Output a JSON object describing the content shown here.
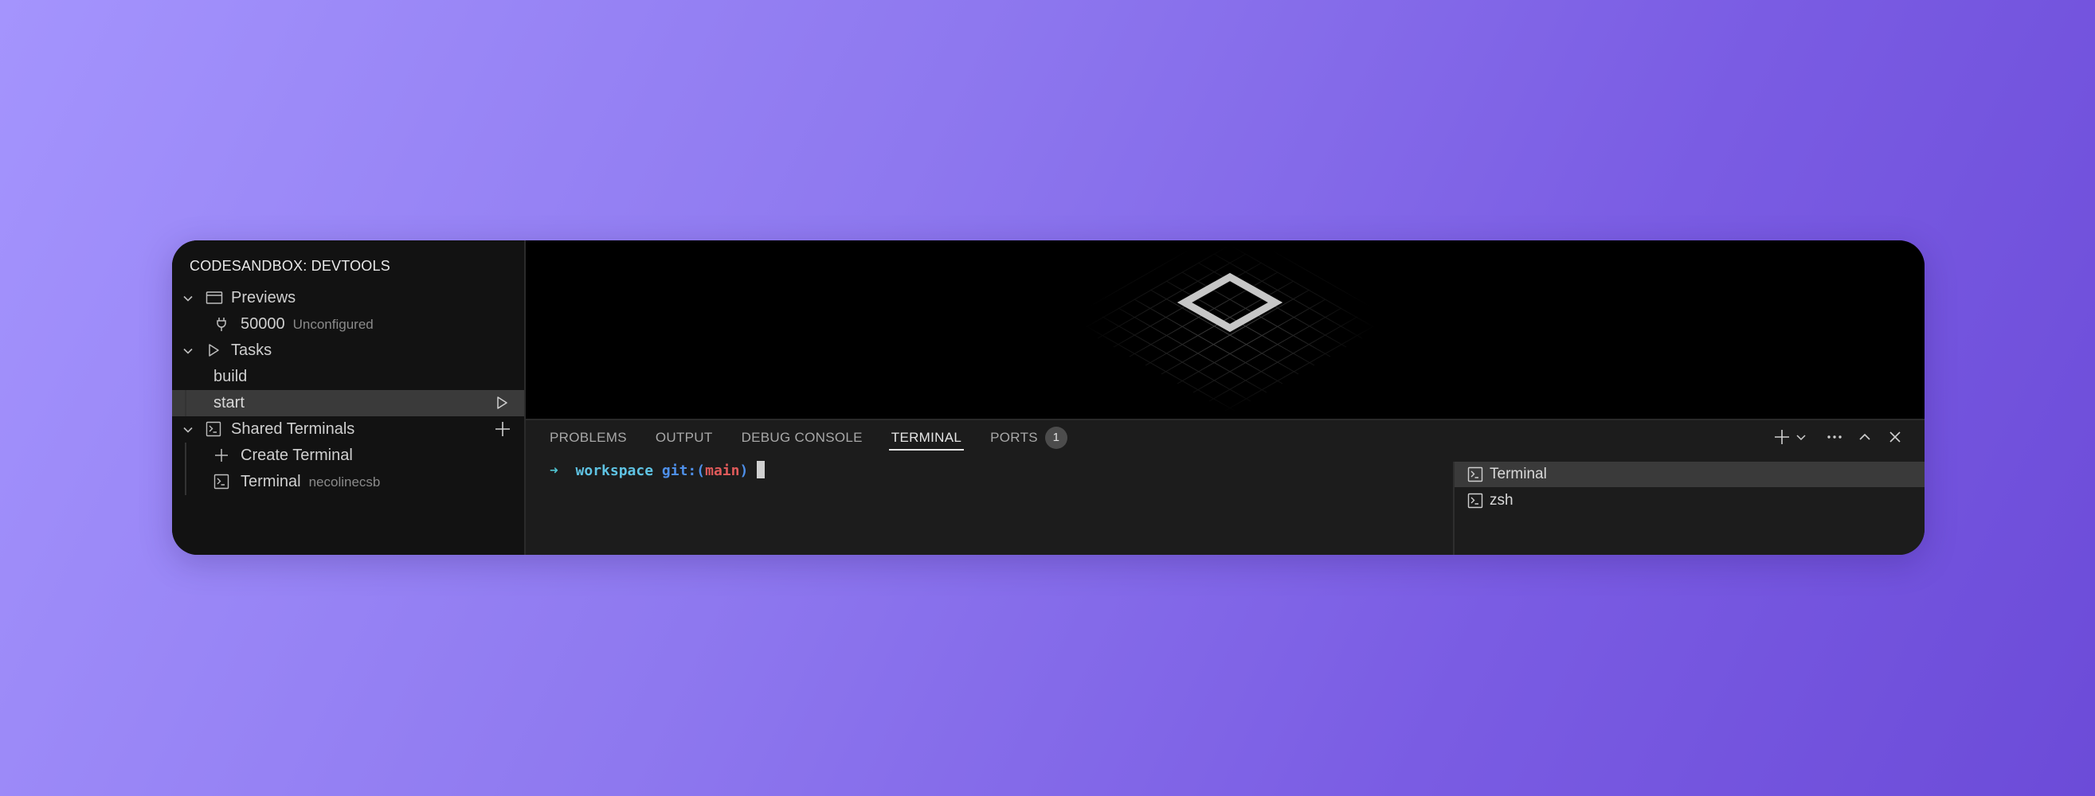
{
  "sidebar": {
    "title": "CODESANDBOX: DEVTOOLS",
    "previews": {
      "label": "Previews",
      "items": [
        {
          "port": "50000",
          "status": "Unconfigured"
        }
      ]
    },
    "tasks": {
      "label": "Tasks",
      "items": [
        {
          "label": "build"
        },
        {
          "label": "start"
        }
      ]
    },
    "shared_terminals": {
      "label": "Shared Terminals",
      "create_label": "Create Terminal",
      "items": [
        {
          "label": "Terminal",
          "owner": "necolinecsb"
        }
      ]
    }
  },
  "panel": {
    "tabs": [
      {
        "label": "PROBLEMS"
      },
      {
        "label": "OUTPUT"
      },
      {
        "label": "DEBUG CONSOLE"
      },
      {
        "label": "TERMINAL",
        "active": true
      },
      {
        "label": "PORTS",
        "badge": "1"
      }
    ],
    "terminal": {
      "arrow": "➜",
      "dir": "workspace",
      "git_prefix": "git:(",
      "branch": "main",
      "git_suffix": ")"
    },
    "terminal_list": [
      {
        "label": "Terminal",
        "selected": true
      },
      {
        "label": "zsh"
      }
    ]
  },
  "colors": {
    "accent_cyan": "#4fc2cf",
    "git_blue": "#4e8fe9",
    "branch_red": "#e05a5a"
  }
}
